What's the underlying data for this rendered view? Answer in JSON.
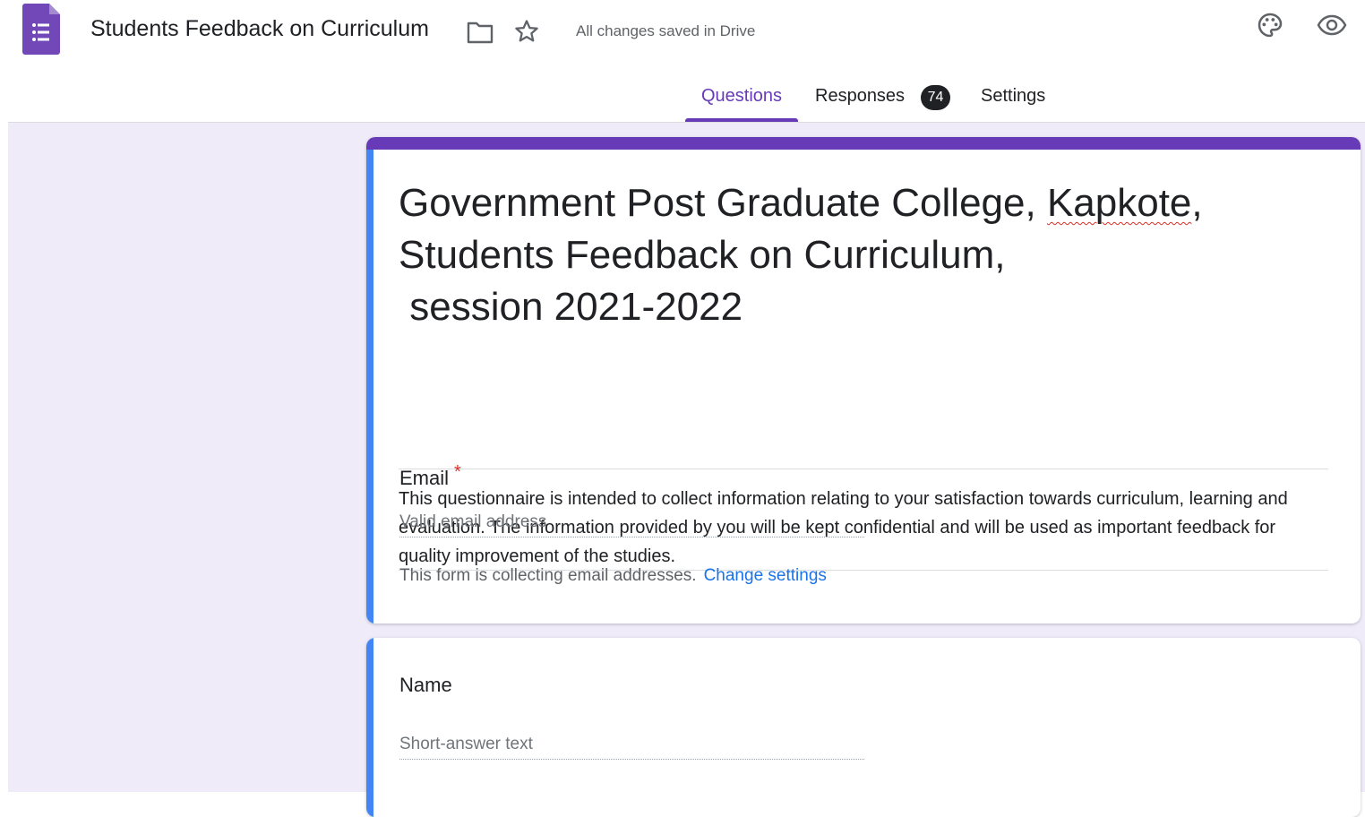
{
  "header": {
    "title": "Students Feedback on Curriculum",
    "save_status": "All changes saved in Drive",
    "icons": {
      "app": "google-forms-icon",
      "folder": "folder-icon",
      "star": "star-icon",
      "palette": "palette-icon",
      "preview": "eye-icon"
    }
  },
  "tabs": [
    {
      "label": "Questions",
      "active": true
    },
    {
      "label": "Responses",
      "badge": "74"
    },
    {
      "label": "Settings"
    }
  ],
  "form": {
    "title_line1_pre": "Government Post Graduate College, ",
    "title_line1_spell": "Kapkote",
    "title_line1_post": ",",
    "title_line2": "Students Feedback on Curriculum,",
    "title_line3": " session 2021-2022",
    "description": "This questionnaire is intended to collect information relating to your satisfaction towards curriculum, learning and evaluation. The information provided by you will be kept confidential and will be used as important feedback for quality improvement of the studies.",
    "email": {
      "label": "Email",
      "required_mark": "*",
      "placeholder": "Valid email address",
      "note": "This form is collecting email addresses.",
      "link": "Change settings"
    },
    "questions": [
      {
        "label": "Name",
        "placeholder": "Short-answer text"
      }
    ]
  },
  "colors": {
    "accent": "#673ab7",
    "focus_bar": "#4285f4",
    "background": "#f0ebf8",
    "link": "#1a73e8",
    "required": "#d93025"
  }
}
